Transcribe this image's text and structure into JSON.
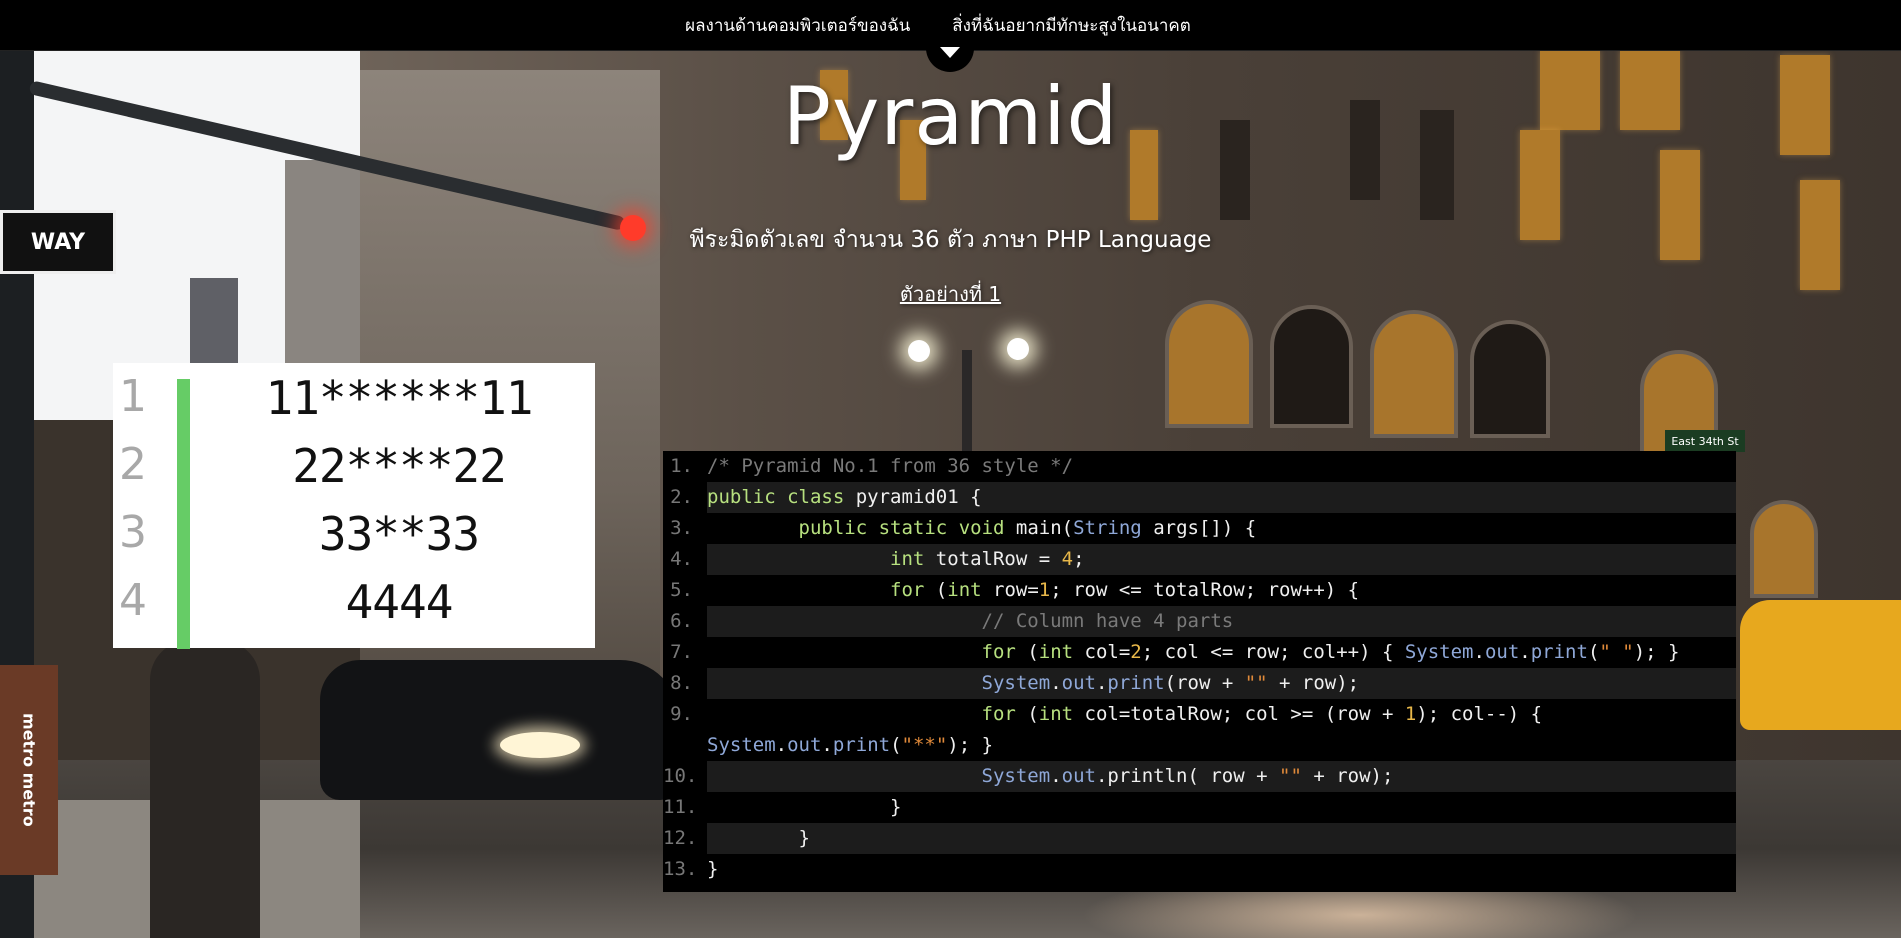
{
  "nav": {
    "link1": "ผลงานด้านคอมพิวเตอร์ของฉัน",
    "link2": "สิ่งที่ฉันอยากมีทักษะสูงในอนาคต"
  },
  "hero": {
    "title": "Pyramid",
    "subtitle": "พีระมิดตัวเลข จำนวน 36 ตัว ภาษา PHP Language",
    "example_link": "ตัวอย่างที่ 1"
  },
  "background_signs": {
    "one_way": "WAY",
    "metro": "metro metro",
    "street": "East 34th St"
  },
  "pyramid_output": [
    {
      "num": "1",
      "text": "11******11"
    },
    {
      "num": "2",
      "text": "22****22"
    },
    {
      "num": "3",
      "text": "33**33"
    },
    {
      "num": "4",
      "text": "4444"
    }
  ],
  "code": [
    {
      "n": "1.",
      "tokens": [
        [
          "cm",
          "/* Pyramid No.1 from 36 style */"
        ]
      ]
    },
    {
      "n": "2.",
      "tokens": [
        [
          "kw",
          "public"
        ],
        [
          "pl",
          " "
        ],
        [
          "kw",
          "class"
        ],
        [
          "pl",
          " pyramid01 {"
        ]
      ]
    },
    {
      "n": "3.",
      "tokens": [
        [
          "pl",
          "        "
        ],
        [
          "kw",
          "public"
        ],
        [
          "pl",
          " "
        ],
        [
          "kw",
          "static"
        ],
        [
          "pl",
          " "
        ],
        [
          "kw",
          "void"
        ],
        [
          "pl",
          " main("
        ],
        [
          "ty",
          "String"
        ],
        [
          "pl",
          " args[]) {"
        ]
      ]
    },
    {
      "n": "4.",
      "tokens": [
        [
          "pl",
          "                "
        ],
        [
          "kw",
          "int"
        ],
        [
          "pl",
          " totalRow = "
        ],
        [
          "nm",
          "4"
        ],
        [
          "pl",
          ";"
        ]
      ]
    },
    {
      "n": "5.",
      "tokens": [
        [
          "pl",
          "                "
        ],
        [
          "kw",
          "for"
        ],
        [
          "pl",
          " ("
        ],
        [
          "kw",
          "int"
        ],
        [
          "pl",
          " row="
        ],
        [
          "nm",
          "1"
        ],
        [
          "pl",
          "; row <= totalRow; row++) {"
        ]
      ]
    },
    {
      "n": "6.",
      "tokens": [
        [
          "pl",
          "                        "
        ],
        [
          "cm",
          "// Column have 4 parts"
        ]
      ]
    },
    {
      "n": "7.",
      "tokens": [
        [
          "pl",
          "                        "
        ],
        [
          "kw",
          "for"
        ],
        [
          "pl",
          " ("
        ],
        [
          "kw",
          "int"
        ],
        [
          "pl",
          " col="
        ],
        [
          "nm",
          "2"
        ],
        [
          "pl",
          "; col <= row; col++) { "
        ],
        [
          "ty",
          "System"
        ],
        [
          "pl",
          "."
        ],
        [
          "ty",
          "out"
        ],
        [
          "pl",
          "."
        ],
        [
          "ty",
          "print"
        ],
        [
          "pl",
          "("
        ],
        [
          "st",
          "\" \""
        ],
        [
          "pl",
          "); }"
        ]
      ]
    },
    {
      "n": "8.",
      "tokens": [
        [
          "pl",
          "                        "
        ],
        [
          "ty",
          "System"
        ],
        [
          "pl",
          "."
        ],
        [
          "ty",
          "out"
        ],
        [
          "pl",
          "."
        ],
        [
          "ty",
          "print"
        ],
        [
          "pl",
          "(row + "
        ],
        [
          "st",
          "\"\""
        ],
        [
          "pl",
          " + row);"
        ]
      ]
    },
    {
      "n": "9.",
      "wrap": true,
      "tokens": [
        [
          "pl",
          "                        "
        ],
        [
          "kw",
          "for"
        ],
        [
          "pl",
          " ("
        ],
        [
          "kw",
          "int"
        ],
        [
          "pl",
          " col=totalRow; col >= (row + "
        ],
        [
          "nm",
          "1"
        ],
        [
          "pl",
          "); col--) {\n"
        ],
        [
          "ty",
          "System"
        ],
        [
          "pl",
          "."
        ],
        [
          "ty",
          "out"
        ],
        [
          "pl",
          "."
        ],
        [
          "ty",
          "print"
        ],
        [
          "pl",
          "("
        ],
        [
          "st",
          "\"**\""
        ],
        [
          "pl",
          "); }"
        ]
      ]
    },
    {
      "n": "10.",
      "tokens": [
        [
          "pl",
          "                        "
        ],
        [
          "ty",
          "System"
        ],
        [
          "pl",
          "."
        ],
        [
          "ty",
          "out"
        ],
        [
          "pl",
          ".println( row + "
        ],
        [
          "st",
          "\"\""
        ],
        [
          "pl",
          " + row);"
        ]
      ]
    },
    {
      "n": "11.",
      "tokens": [
        [
          "pl",
          "                }"
        ]
      ]
    },
    {
      "n": "12.",
      "tokens": [
        [
          "pl",
          "        }"
        ]
      ]
    },
    {
      "n": "13.",
      "tokens": [
        [
          "pl",
          "}"
        ]
      ]
    }
  ],
  "colors": {
    "navbar_bg": "#000000",
    "code_bg": "#000000",
    "keyword": "#b7e07f",
    "comment": "#7a7a7a",
    "type": "#8fa8d8",
    "string": "#e08a3a",
    "number": "#e8b84a",
    "pyramid_bar": "#66cc66"
  }
}
